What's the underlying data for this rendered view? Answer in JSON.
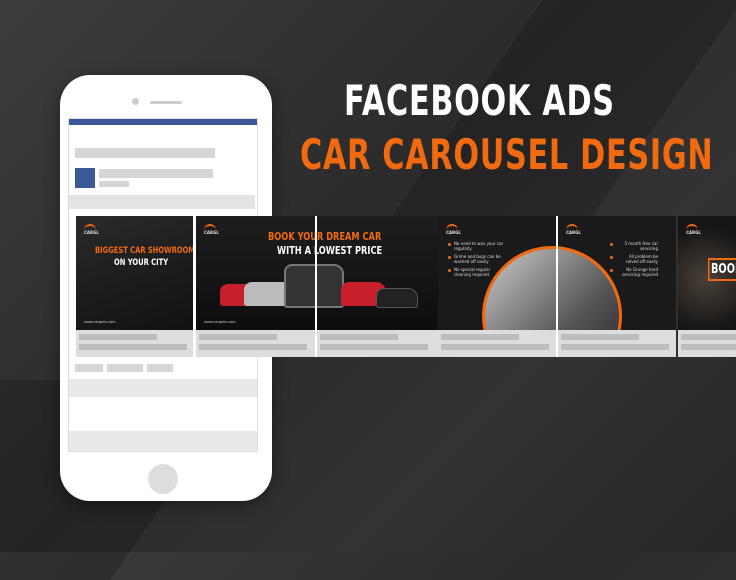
{
  "title": {
    "line1": "FACEBOOK ADS",
    "line2": "CAR CAROUSEL DESIGN"
  },
  "colors": {
    "accent": "#f26a10",
    "facebook": "#3b5998",
    "background": "#2f2f2f"
  },
  "cards": [
    {
      "logo": "CARGL",
      "headline_a": "BIGGEST CAR SHOWROOM",
      "headline_b": "ON YOUR CITY",
      "website": "www.cargolis.com"
    },
    {
      "logo": "CARGL",
      "headline_a": "BOOK YOUR DREAM CAR",
      "headline_b": "WITH A LOWEST PRICE",
      "website": "www.cargolis.com"
    },
    {
      "logo": "CARGL",
      "bullets": [
        "No need to wax your car regularly",
        "Grime and bugs can be washed off easily",
        "No special regular cleaning required"
      ]
    },
    {
      "logo": "CARGL",
      "bullets": [
        "5 month free car servicing",
        "All problem be solved off easily",
        "No Grunge hard servicing required"
      ]
    },
    {
      "logo": "CARGL",
      "headline_a": "BOOK"
    }
  ]
}
